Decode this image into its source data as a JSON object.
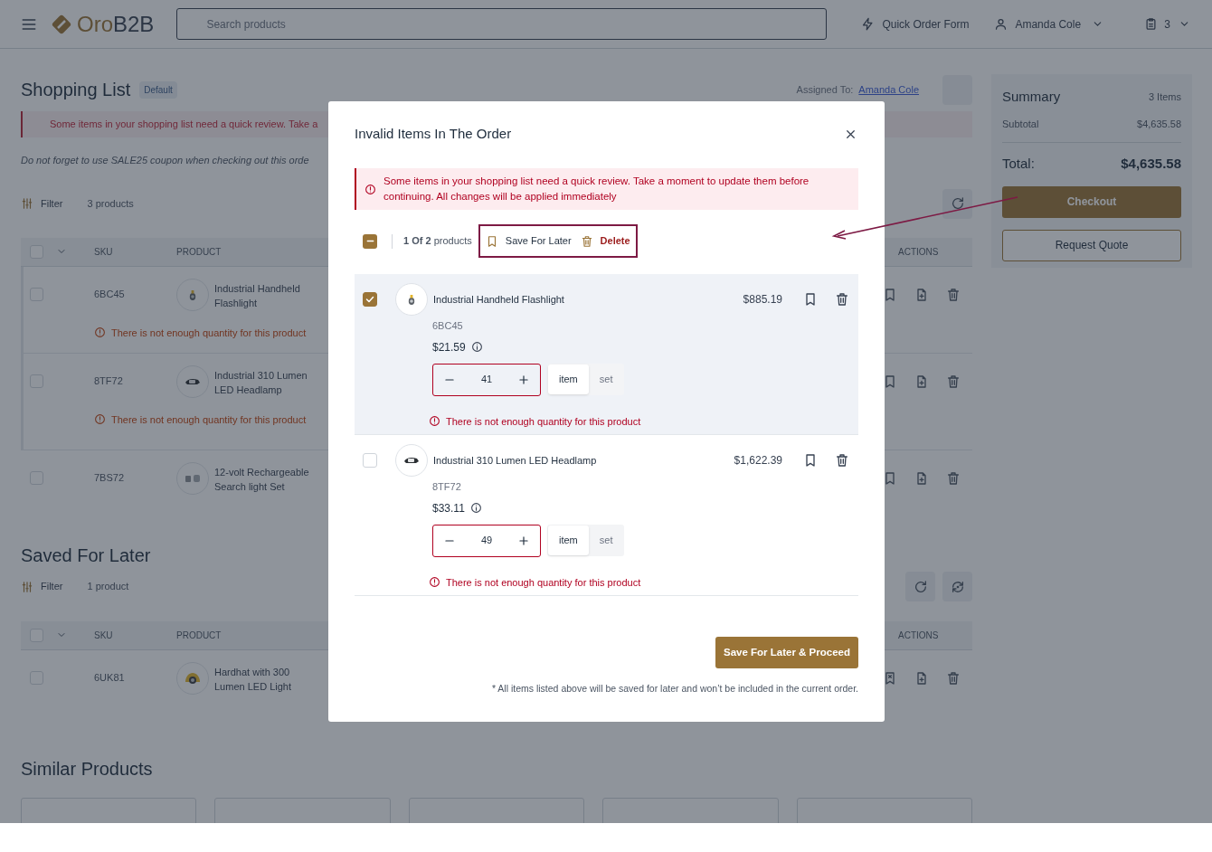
{
  "header": {
    "logo": {
      "part_1": "Oro",
      "part_2": "B2B"
    },
    "search": {
      "placeholder": "Search products"
    },
    "quick_order": "Quick Order Form",
    "user": "Amanda Cole",
    "cart_count": "3"
  },
  "shopping_list": {
    "title": "Shopping List",
    "badge": "Default",
    "assigned_label": "Assigned To:",
    "assigned_name": "Amanda Cole",
    "alert": "Some items in your shopping list need a quick review. Take a",
    "note": "Do not forget to use SALE25 coupon when checking out this orde",
    "filter": "Filter",
    "count": "3 products",
    "select_all_checked": false,
    "columns": [
      "SKU",
      "PRODUCT",
      "ACTIONS"
    ],
    "rows": [
      {
        "sku": "6BC45",
        "product": "Industrial Handheld Flashlight",
        "kind": "flashlight",
        "checked": false,
        "invalid": true,
        "warning": "There is not enough quantity for this product"
      },
      {
        "sku": "8TF72",
        "product": "Industrial 310 Lumen LED Headlamp",
        "kind": "headlamp",
        "checked": false,
        "invalid": true,
        "warning": "There is not enough quantity for this product"
      },
      {
        "sku": "7BS72",
        "product": "12-volt Rechargeable Search light Set",
        "kind": "searchlight",
        "checked": false,
        "invalid": false
      }
    ]
  },
  "saved_for_later": {
    "title": "Saved For Later",
    "filter": "Filter",
    "count": "1 product",
    "select_all_checked": false,
    "columns": [
      "SKU",
      "PRODUCT",
      "ACTIONS"
    ],
    "rows": [
      {
        "sku": "6UK81",
        "product": "Hardhat with 300 Lumen LED Light",
        "kind": "hardhat",
        "checked": false
      }
    ]
  },
  "similar_products": {
    "title": "Similar Products"
  },
  "summary": {
    "title": "Summary",
    "items": "3 Items",
    "subtotal_label": "Subtotal",
    "subtotal": "$4,635.58",
    "total_label": "Total:",
    "total": "$4,635.58",
    "checkout": "Checkout",
    "request_quote": "Request Quote"
  },
  "modal": {
    "title": "Invalid Items In The Order",
    "alert": "Some items in your shopping list need a quick review. Take a moment to update them before continuing. All changes will be applied immediately",
    "bulk": {
      "indeterminate": true,
      "count": "**1 Of 2** products",
      "save": "Save For Later",
      "delete": "Delete"
    },
    "items": [
      {
        "name": "Industrial Handheld Flashlight",
        "kind": "flashlight",
        "checked": true,
        "sku": "6BC45",
        "unit_price": "$21.59",
        "total": "$885.19",
        "quantity": "41",
        "units": [
          {
            "label": "item",
            "selected": true
          },
          {
            "label": "set",
            "selected": false
          }
        ],
        "warning": "There is not enough quantity for this product"
      },
      {
        "name": "Industrial 310 Lumen LED Headlamp",
        "kind": "headlamp",
        "checked": false,
        "sku": "8TF72",
        "unit_price": "$33.11",
        "total": "$1,622.39",
        "quantity": "49",
        "units": [
          {
            "label": "item",
            "selected": true
          },
          {
            "label": "set",
            "selected": false
          }
        ],
        "warning": "There is not enough quantity for this product"
      }
    ],
    "proceed": "Save For Later & Proceed",
    "footnote": "* All items listed above will be saved for later and won’t be included in the current order."
  }
}
